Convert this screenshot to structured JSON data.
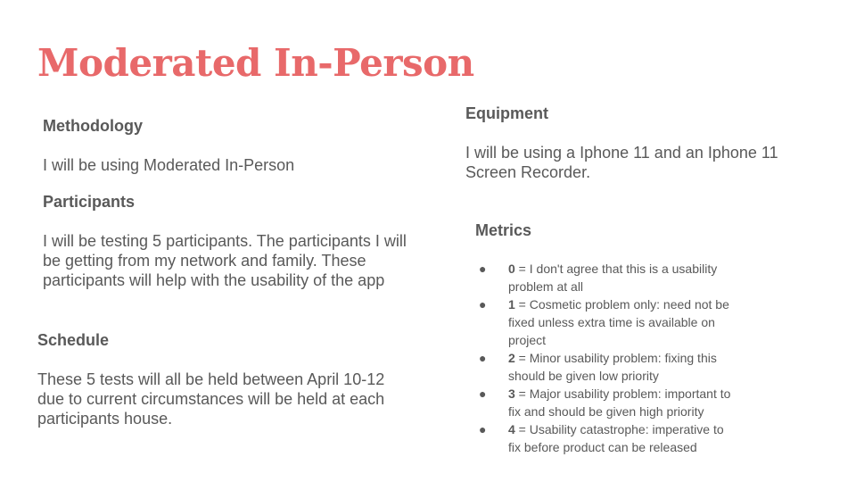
{
  "title": "Moderated In-Person",
  "methodology": {
    "heading": "Methodology",
    "text": "I will be using Moderated In-Person"
  },
  "participants": {
    "heading": "Participants",
    "text": "I will be testing 5 participants. The participants I will be getting from my network and family. These participants will help with the usability of the app"
  },
  "schedule": {
    "heading": "Schedule",
    "text": "These 5 tests will all be held between April 10-12 due to current circumstances will be held at each participants house."
  },
  "equipment": {
    "heading": "Equipment",
    "text": "I will be using a Iphone 11 and an Iphone 11 Screen Recorder."
  },
  "metrics": {
    "heading": "Metrics",
    "bullet": "●",
    "items": [
      {
        "num": "0",
        "text": " = I don't agree that this is a usability problem at all"
      },
      {
        "num": "1",
        "text": " = Cosmetic problem only: need not be fixed unless extra time is available on project"
      },
      {
        "num": "2",
        "text": " = Minor usability problem: fixing this should be given low priority"
      },
      {
        "num": "3",
        "text": " = Major usability problem: important to fix and should be given high priority"
      },
      {
        "num": "4",
        "text": " = Usability catastrophe: imperative to fix before product can be released"
      }
    ]
  },
  "colors": {
    "title": "#e8696a",
    "text": "#595959"
  }
}
